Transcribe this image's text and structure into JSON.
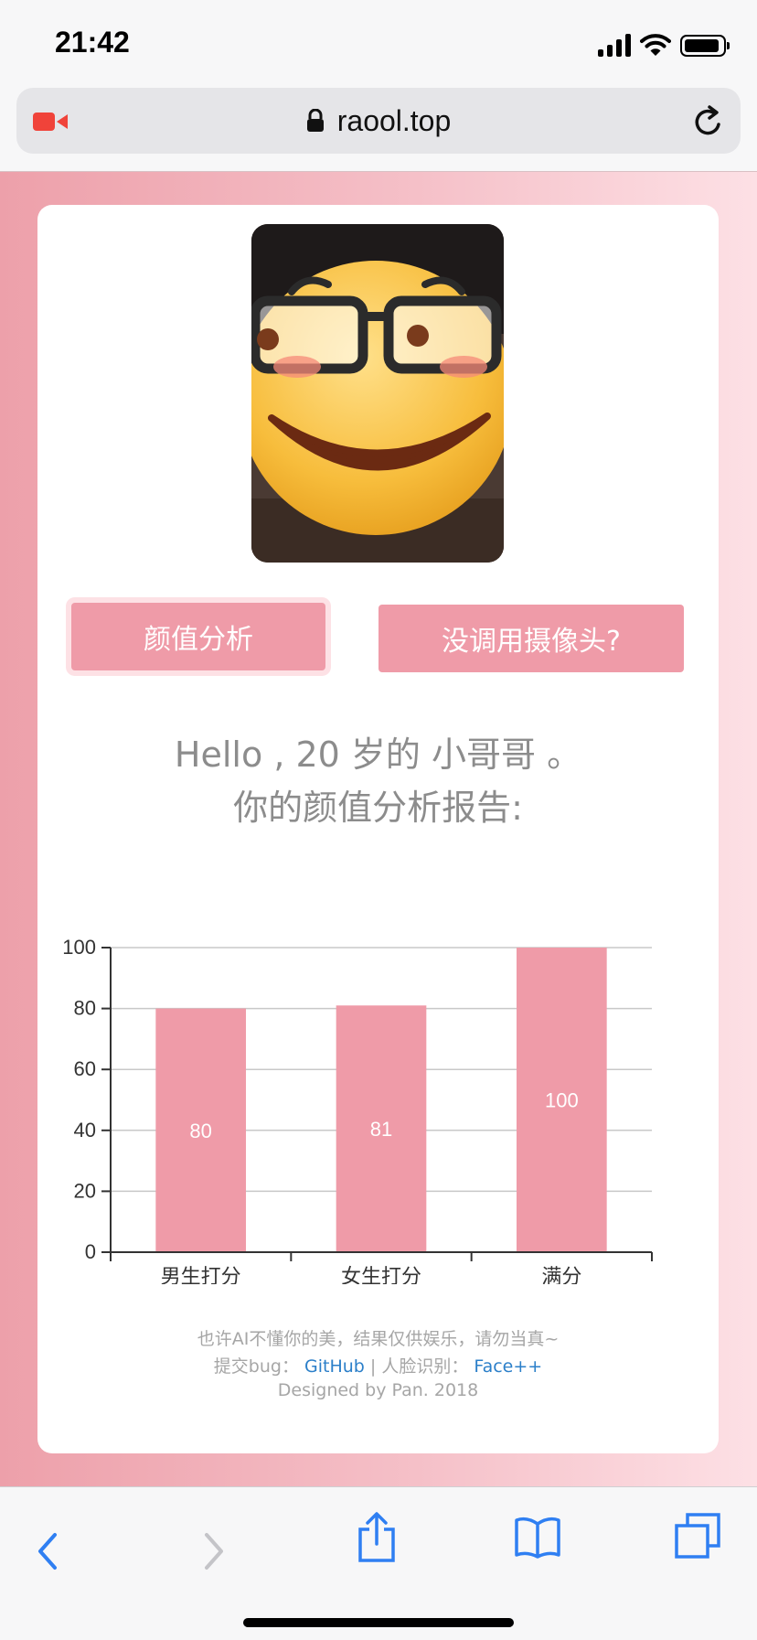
{
  "status_bar": {
    "time": "21:42"
  },
  "browser": {
    "url": "raool.top"
  },
  "buttons": {
    "analyze": "颜值分析",
    "no_camera": "没调用摄像头?"
  },
  "greeting": {
    "line1": "Hello , 20 岁的 小哥哥 。",
    "line2": "你的颜值分析报告:"
  },
  "chart_data": {
    "type": "bar",
    "categories": [
      "男生打分",
      "女生打分",
      "满分"
    ],
    "values": [
      80,
      81,
      100
    ],
    "ylim": [
      0,
      100
    ],
    "yticks": [
      0,
      20,
      40,
      60,
      80,
      100
    ],
    "grid": true,
    "bar_color": "#ef9ba8"
  },
  "footer": {
    "disclaimer": "也许AI不懂你的美，结果仅供娱乐，请勿当真~",
    "bug_prefix": "提交bug：",
    "github": "GitHub",
    "separator": "| 人脸识别：",
    "facepp": "Face++",
    "credit": "Designed by Pan. 2018"
  },
  "colors": {
    "accent": "#ef9ba8",
    "link": "#2b7fc9",
    "toolbar_blue": "#2f7ff2"
  },
  "toolbar": {
    "icons": [
      "back-icon",
      "forward-icon",
      "share-icon",
      "bookmarks-icon",
      "tabs-icon"
    ]
  }
}
